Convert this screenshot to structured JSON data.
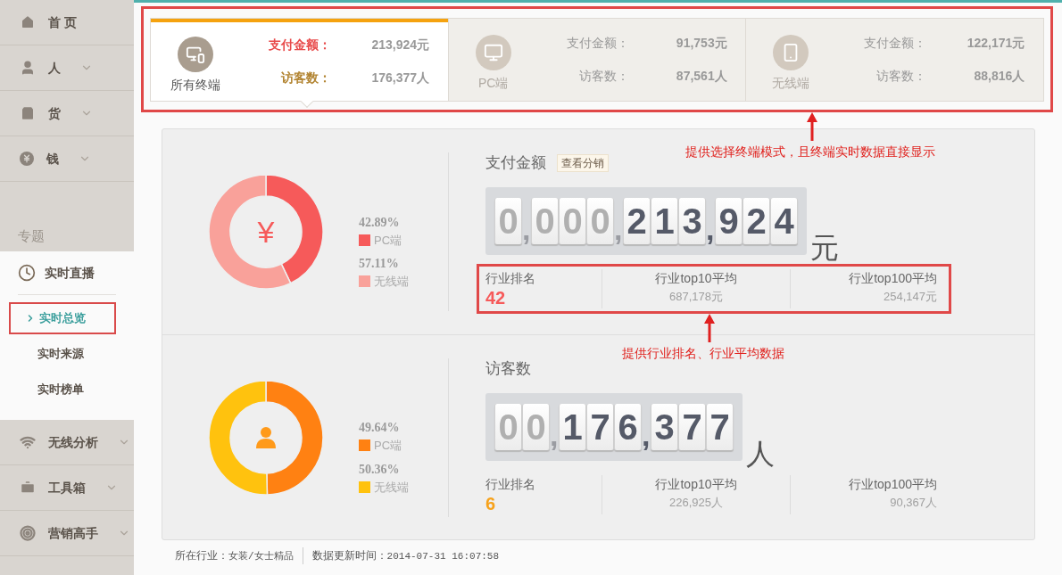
{
  "sidebar": {
    "top_items": [
      {
        "label": "首 页",
        "expandable": false
      },
      {
        "label": "人",
        "expandable": true
      },
      {
        "label": "货",
        "expandable": true
      },
      {
        "label": "钱",
        "expandable": true
      }
    ],
    "section": {
      "title": "专题",
      "group": {
        "label": "实时直播",
        "children": [
          {
            "label": "实时总览",
            "selected": true,
            "highlighted": true
          },
          {
            "label": "实时来源",
            "selected": false,
            "highlighted": false
          },
          {
            "label": "实时榜单",
            "selected": false,
            "highlighted": false
          }
        ]
      }
    },
    "bottom_items": [
      {
        "label": "无线分析",
        "expandable": true
      },
      {
        "label": "工具箱",
        "expandable": true
      },
      {
        "label": "营销高手",
        "expandable": true
      }
    ]
  },
  "tabs": [
    {
      "label": "所有终端",
      "selected": true,
      "metrics": [
        {
          "label": "支付金额：",
          "value": "213,924元"
        },
        {
          "label": "访客数：",
          "value": "176,377人"
        }
      ]
    },
    {
      "label": "PC端",
      "selected": false,
      "metrics": [
        {
          "label": "支付金额：",
          "value": "91,753元"
        },
        {
          "label": "访客数：",
          "value": "87,561人"
        }
      ]
    },
    {
      "label": "无线端",
      "selected": false,
      "metrics": [
        {
          "label": "支付金额：",
          "value": "122,171元"
        },
        {
          "label": "访客数：",
          "value": "88,816人"
        }
      ]
    }
  ],
  "sections": [
    {
      "title": "支付金额",
      "button": "查看分销",
      "symbol": "¥",
      "chart_data": {
        "type": "donut",
        "categories": [
          "PC端",
          "无线端"
        ],
        "values": [
          42.89,
          57.11
        ]
      },
      "legend": [
        {
          "percent": "42.89%",
          "color": "#f65a5a"
        },
        {
          "percent": "57.11%",
          "color": "#f9a19a"
        }
      ],
      "counter": "0,000,213,924",
      "unit": "元",
      "stats": [
        {
          "kind": "rank",
          "label": "行业排名",
          "value": "42",
          "color": "#f65a5a"
        },
        {
          "kind": "average",
          "label": "行业top10平均",
          "value": "687,178元"
        },
        {
          "kind": "average",
          "label": "行业top100平均",
          "value": "254,147元"
        }
      ]
    },
    {
      "title": "访客数",
      "chart_data": {
        "type": "donut",
        "categories": [
          "PC端",
          "无线端"
        ],
        "values": [
          49.64,
          50.36
        ]
      },
      "legend": [
        {
          "percent": "49.64%",
          "color": "#ff8112"
        },
        {
          "percent": "50.36%",
          "color": "#ffc20e"
        }
      ],
      "counter": "00,176,377",
      "unit": "人",
      "stats": [
        {
          "kind": "rank",
          "label": "行业排名",
          "value": "6",
          "color": "#f7a21b"
        },
        {
          "kind": "average",
          "label": "行业top10平均",
          "value": "226,925人"
        },
        {
          "kind": "average",
          "label": "行业top100平均",
          "value": "90,367人"
        }
      ]
    }
  ],
  "annotations": [
    {
      "text": "提供选择终端模式，且终端实时数据直接显示"
    },
    {
      "text": "提供行业排名、行业平均数据"
    }
  ],
  "footer": [
    {
      "label": "所在行业：",
      "value": "女装/女士精品"
    },
    {
      "label": "数据更新时间：",
      "value": "2014-07-31 16:07:58"
    }
  ]
}
